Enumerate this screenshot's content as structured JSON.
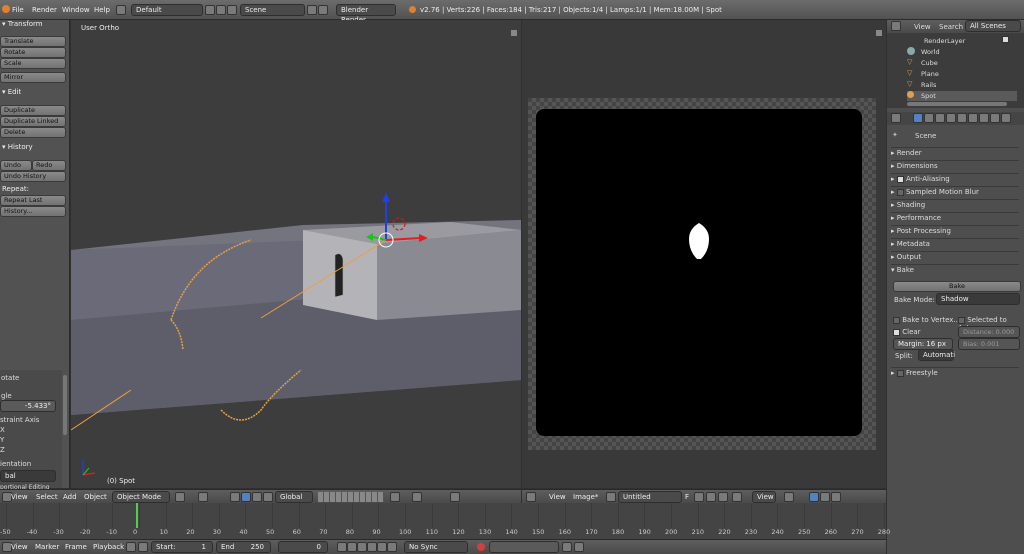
{
  "topbar": {
    "menus": [
      "File",
      "Render",
      "Window",
      "Help"
    ],
    "layout": "Default",
    "scene": "Scene",
    "engine": "Blender Render",
    "stats": "v2.76 | Verts:226 | Faces:184 | Tris:217 | Objects:1/4 | Lamps:1/1 | Mem:18.00M | Spot"
  },
  "toolshelf": {
    "transform_title": "Transform",
    "transform": [
      "Translate",
      "Rotate",
      "Scale",
      "Mirror"
    ],
    "edit_title": "Edit",
    "edit": [
      "Duplicate",
      "Duplicate Linked",
      "Delete"
    ],
    "history_title": "History",
    "undo": "Undo",
    "redo": "Redo",
    "undo_history": "Undo History",
    "repeat_label": "Repeat:",
    "repeat_last": "Repeat Last",
    "history_btn": "History...",
    "op_title": "otate",
    "op_angle_label": "gle",
    "op_angle": "-5.433°",
    "op_constraint": "straint Axis",
    "op_axes": [
      "X",
      "Y",
      "Z"
    ],
    "op_orient_label": "ientation",
    "op_orient": "bal",
    "op_more": "portional Editing"
  },
  "viewport": {
    "label": "User Ortho",
    "object_label": "(0) Spot",
    "header": {
      "menus": [
        "View",
        "Select",
        "Add",
        "Object"
      ],
      "mode": "Object Mode",
      "orientation": "Global"
    }
  },
  "imageeditor": {
    "header": {
      "menus": [
        "View",
        "Image*"
      ],
      "image_name": "Untitled",
      "f_label": "F",
      "view_menu": "View"
    }
  },
  "outliner": {
    "tabs": [
      "View",
      "Search",
      "All Scenes"
    ],
    "items": [
      {
        "label": "RenderLayer",
        "indent": 1
      },
      {
        "label": "World",
        "indent": 1
      },
      {
        "label": "Cube",
        "indent": 1
      },
      {
        "label": "Plane",
        "indent": 1
      },
      {
        "label": "Rails",
        "indent": 1
      },
      {
        "label": "Spot",
        "indent": 1
      }
    ]
  },
  "properties": {
    "scene": "Scene",
    "panels": [
      "Render",
      "Dimensions",
      "Anti-Aliasing",
      "Sampled Motion Blur",
      "Shading",
      "Performance",
      "Post Processing",
      "Metadata",
      "Output"
    ],
    "bake": {
      "title": "Bake",
      "button": "Bake",
      "mode_label": "Bake Mode:",
      "mode": "Shadow",
      "to_vertex": "Bake to Vertex...",
      "selected_to_active": "Selected to Act...",
      "clear": "Clear",
      "distance": "Distance: 0.000",
      "margin": "Margin:",
      "margin_val": "16 px",
      "bias": "Bias: 0.001",
      "split_label": "Split:",
      "split": "Automati"
    },
    "freestyle": "Freestyle"
  },
  "timeline": {
    "ticks": [
      "-50",
      "-40",
      "-30",
      "-20",
      "-10",
      "0",
      "10",
      "20",
      "30",
      "40",
      "50",
      "60",
      "70",
      "80",
      "90",
      "100",
      "110",
      "120",
      "130",
      "140",
      "150",
      "160",
      "170",
      "180",
      "190",
      "200",
      "210",
      "220",
      "230",
      "240",
      "250",
      "260",
      "270",
      "280"
    ],
    "menus": [
      "View",
      "Marker",
      "Frame",
      "Playback"
    ],
    "start_label": "Start:",
    "start": "1",
    "end_label": "End",
    "end": "250",
    "current": "0",
    "sync": "No Sync"
  }
}
